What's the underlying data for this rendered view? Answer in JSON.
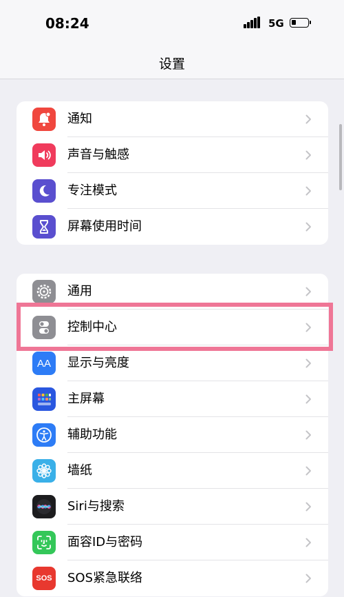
{
  "status_bar": {
    "time": "08:24",
    "network": "5G"
  },
  "nav": {
    "title": "设置"
  },
  "group1": {
    "items": [
      {
        "label": "通知",
        "icon": "notification-icon",
        "color": "#f0473e"
      },
      {
        "label": "声音与触感",
        "icon": "speaker-icon",
        "color": "#f03b5c"
      },
      {
        "label": "专注模式",
        "icon": "moon-icon",
        "color": "#5a4fcf"
      },
      {
        "label": "屏幕使用时间",
        "icon": "hourglass-icon",
        "color": "#5a4fcf"
      }
    ]
  },
  "group2": {
    "items": [
      {
        "label": "通用",
        "icon": "gear-icon",
        "color": "#8e8e93"
      },
      {
        "label": "控制中心",
        "icon": "toggles-icon",
        "color": "#8e8e93"
      },
      {
        "label": "显示与亮度",
        "icon": "display-icon",
        "color": "#2d7cf6",
        "icon_text": "AA"
      },
      {
        "label": "主屏幕",
        "icon": "home-screen-icon",
        "color": "#2a57e0"
      },
      {
        "label": "辅助功能",
        "icon": "accessibility-icon",
        "color": "#2d7cf6"
      },
      {
        "label": "墙纸",
        "icon": "wallpaper-flower-icon",
        "color": "#3ab0e8"
      },
      {
        "label": "Siri与搜索",
        "icon": "siri-icon",
        "color": "#1c1c1e"
      },
      {
        "label": "面容ID与密码",
        "icon": "face-id-icon",
        "color": "#34c759"
      },
      {
        "label": "SOS紧急联络",
        "icon": "sos-icon",
        "color": "#e8382f",
        "icon_text": "SOS"
      }
    ]
  },
  "highlight": {
    "color": "#ef7696",
    "target": "控制中心"
  }
}
